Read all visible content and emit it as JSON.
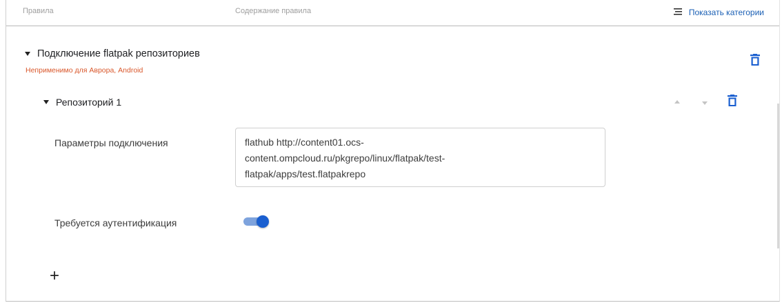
{
  "header": {
    "rules_col": "Правила",
    "content_col": "Содержание правила",
    "show_categories": "Показать категории"
  },
  "section": {
    "title": "Подключение flatpak репозиториев",
    "warning": "Неприменимо для Аврора, Android",
    "warning_color": "#d9572b"
  },
  "repo": {
    "title": "Репозиторий 1",
    "params_label": "Параметры подключения",
    "params_value": "flathub http://content01.ocs-\ncontent.ompcloud.ru/pkgrepo/linux/flatpak/test-\nflatpak/apps/test.flatpakrepo",
    "auth_label": "Требуется аутентификация",
    "auth_enabled": true
  },
  "colors": {
    "accent": "#1a5fd0",
    "link": "#1a5fb4"
  },
  "icons": [
    "menu-lines-icon",
    "trash-icon",
    "caret-down-icon",
    "arrow-up-icon",
    "arrow-down-icon",
    "plus-icon"
  ],
  "add_label": "+"
}
